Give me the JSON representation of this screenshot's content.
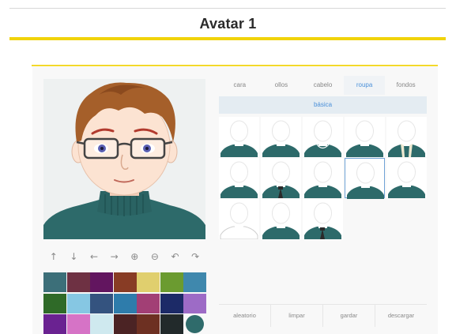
{
  "page": {
    "title": "Avatar 1"
  },
  "tabs": [
    {
      "label": "cara"
    },
    {
      "label": "ollos"
    },
    {
      "label": "cabelo"
    },
    {
      "label": "roupa",
      "active": true
    },
    {
      "label": "fondos"
    }
  ],
  "subtab": {
    "label": "básica"
  },
  "controls": [
    {
      "name": "move-up-button",
      "icon": "arrow-up-icon",
      "glyph": "↑"
    },
    {
      "name": "move-down-button",
      "icon": "arrow-down-icon",
      "glyph": "↓"
    },
    {
      "name": "move-left-button",
      "icon": "arrow-left-icon",
      "glyph": "←"
    },
    {
      "name": "move-right-button",
      "icon": "arrow-right-icon",
      "glyph": "→"
    },
    {
      "name": "zoom-in-button",
      "icon": "zoom-in-icon",
      "glyph": "⊕"
    },
    {
      "name": "zoom-out-button",
      "icon": "zoom-out-icon",
      "glyph": "⊖"
    },
    {
      "name": "undo-button",
      "icon": "undo-icon",
      "glyph": "↶"
    },
    {
      "name": "redo-button",
      "icon": "redo-icon",
      "glyph": "↷"
    }
  ],
  "palette": [
    [
      "#3c6f79",
      "#6e3143",
      "#62155f",
      "#883c25",
      "#e0cf6e",
      "#6b9b30",
      "#3f88ad"
    ],
    [
      "#2f6a28",
      "#86c7e3",
      "#34537f",
      "#2e7cab",
      "#a23f75",
      "#1c2a67",
      "#9d6bc6"
    ],
    [
      "#6a2291",
      "#d673c6",
      "#cfe9ef",
      "#4b2324",
      "#6d3022",
      "#222a2b",
      "#2f6b6b"
    ]
  ],
  "selected_color": "#2f6b6b",
  "clothing_options": [
    {
      "style": "sweater"
    },
    {
      "style": "sweater"
    },
    {
      "style": "necklace"
    },
    {
      "style": "sweater"
    },
    {
      "style": "scarf"
    },
    {
      "style": "sweater"
    },
    {
      "style": "tie"
    },
    {
      "style": "sweater"
    },
    {
      "style": "sweater",
      "selected": true
    },
    {
      "style": "sweater"
    },
    {
      "style": "white"
    },
    {
      "style": "sweater"
    },
    {
      "style": "tie"
    }
  ],
  "actions": [
    {
      "label": "aleatorio"
    },
    {
      "label": "limpar"
    },
    {
      "label": "gardar"
    },
    {
      "label": "descargar"
    }
  ],
  "colors": {
    "accent_yellow": "#f1d30b",
    "link_blue": "#4a90d9",
    "clothing_teal": "#2d6a6a",
    "skin": "#fce3d2",
    "hair": "#a55f2a"
  }
}
